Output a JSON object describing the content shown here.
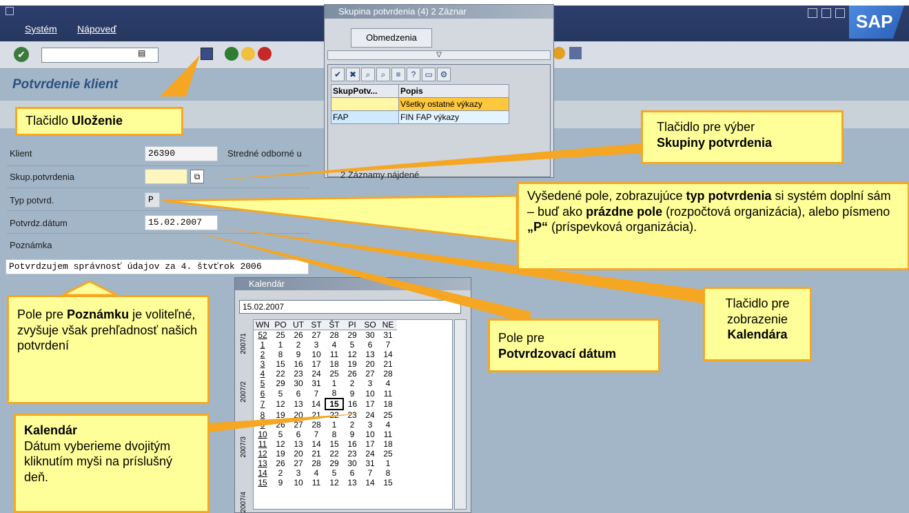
{
  "menubar": {
    "system": "Systém",
    "help": "Nápoveď",
    "logo": "SAP"
  },
  "page": {
    "title": "Potvrdenie klient"
  },
  "fields": {
    "client_label": "Klient",
    "client_value": "26390",
    "client_desc": "Stredné odborné u",
    "group_label": "Skup.potvrdenia",
    "type_label": "Typ potvrd.",
    "type_value": "P",
    "date_label": "Potvrdz.dátum",
    "date_value": "15.02.2007",
    "note_label": "Poznámka",
    "note_value": "Potvrdzujem správnosť údajov za 4. štvťrok 2006"
  },
  "group_dialog": {
    "title": "Skupina potvrdenia (4)  2 Záznar",
    "tab": "Obmedzenia",
    "col1": "SkupPotv...",
    "col2": "Popis",
    "rows": [
      {
        "code": "",
        "desc": "Všetky ostatné výkazy"
      },
      {
        "code": "FAP",
        "desc": "FIN FAP výkazy"
      }
    ],
    "status": "2 Záznamy nájdené"
  },
  "calendar": {
    "title": "Kalendár",
    "input": "15.02.2007",
    "headers": [
      "WN",
      "PO",
      "UT",
      "ST",
      "ŠT",
      "PI",
      "SO",
      "NE"
    ],
    "rows": [
      [
        "52",
        "25",
        "26",
        "27",
        "28",
        "29",
        "30",
        "31"
      ],
      [
        "1",
        "1",
        "2",
        "3",
        "4",
        "5",
        "6",
        "7"
      ],
      [
        "2",
        "8",
        "9",
        "10",
        "11",
        "12",
        "13",
        "14"
      ],
      [
        "3",
        "15",
        "16",
        "17",
        "18",
        "19",
        "20",
        "21"
      ],
      [
        "4",
        "22",
        "23",
        "24",
        "25",
        "26",
        "27",
        "28"
      ],
      [
        "5",
        "29",
        "30",
        "31",
        "1",
        "2",
        "3",
        "4"
      ],
      [
        "6",
        "5",
        "6",
        "7",
        "8",
        "9",
        "10",
        "11"
      ],
      [
        "7",
        "12",
        "13",
        "14",
        "15",
        "16",
        "17",
        "18"
      ],
      [
        "8",
        "19",
        "20",
        "21",
        "22",
        "23",
        "24",
        "25"
      ],
      [
        "9",
        "26",
        "27",
        "28",
        "1",
        "2",
        "3",
        "4"
      ],
      [
        "10",
        "5",
        "6",
        "7",
        "8",
        "9",
        "10",
        "11"
      ],
      [
        "11",
        "12",
        "13",
        "14",
        "15",
        "16",
        "17",
        "18"
      ],
      [
        "12",
        "19",
        "20",
        "21",
        "22",
        "23",
        "24",
        "25"
      ],
      [
        "13",
        "26",
        "27",
        "28",
        "29",
        "30",
        "31",
        "1"
      ],
      [
        "14",
        "2",
        "3",
        "4",
        "5",
        "6",
        "7",
        "8"
      ],
      [
        "15",
        "9",
        "10",
        "11",
        "12",
        "13",
        "14",
        "15"
      ]
    ],
    "months": [
      "2007/1",
      "2007/2",
      "2007/3",
      "2007/4"
    ]
  },
  "callouts": {
    "save": "Tlačidlo ",
    "save_b": "Uloženie",
    "group": "Tlačidlo pre výber ",
    "group_b": "Skupiny potvrdenia",
    "type_1": "Vyšedené pole, zobrazujúce ",
    "type_b1": "typ potvrdenia",
    "type_2": " si systém doplní sám – buď ako ",
    "type_b2": "prázdne pole",
    "type_3": " (rozpočtová organizácia), alebo písmeno ",
    "type_b3": "„P“",
    "type_4": " (príspevková organizácia).",
    "calbtn": "Tlačidlo pre zobrazenie ",
    "calbtn_b": "Kalendára",
    "datefield": "Pole pre ",
    "datefield_b": "Potvrdzovací dátum",
    "note": "Pole pre ",
    "note_b": "Poznámku",
    "note_2": " je voliteľné, zvyšuje však prehľadnosť našich potvrdení",
    "cal_b": "Kalendár",
    "cal": "Dátum vyberieme dvojitým kliknutím myši na príslušný deň."
  }
}
